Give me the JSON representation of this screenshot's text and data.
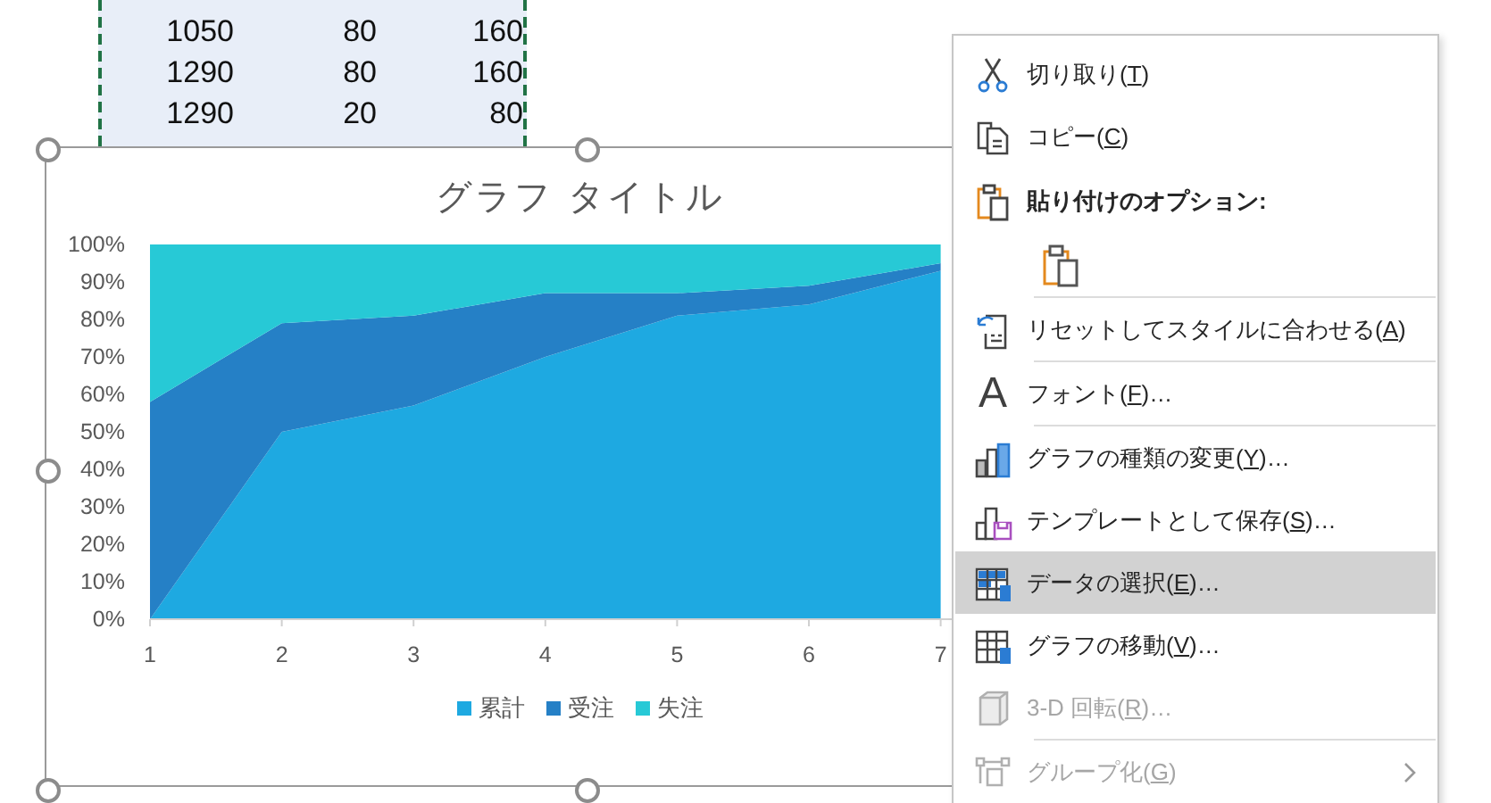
{
  "sheet": {
    "rows": [
      [
        "1050",
        "80",
        "160"
      ],
      [
        "1290",
        "80",
        "160"
      ],
      [
        "1290",
        "20",
        "80"
      ]
    ]
  },
  "chart": {
    "title": "グラフ タイトル",
    "chart_data": {
      "type": "area",
      "stacked": true,
      "categories": [
        "1",
        "2",
        "3",
        "4",
        "5",
        "6",
        "7"
      ],
      "yticks": [
        {
          "value": 0,
          "label": "0%"
        },
        {
          "value": 10,
          "label": "10%"
        },
        {
          "value": 20,
          "label": "20%"
        },
        {
          "value": 30,
          "label": "30%"
        },
        {
          "value": 40,
          "label": "40%"
        },
        {
          "value": 50,
          "label": "50%"
        },
        {
          "value": 60,
          "label": "60%"
        },
        {
          "value": 70,
          "label": "70%"
        },
        {
          "value": 80,
          "label": "80%"
        },
        {
          "value": 90,
          "label": "90%"
        },
        {
          "value": 100,
          "label": "100%"
        }
      ],
      "ylim": [
        0,
        100
      ],
      "series": [
        {
          "name": "累計",
          "color": "#1ea9e1",
          "values": [
            0,
            50,
            57,
            70,
            81,
            84,
            93
          ]
        },
        {
          "name": "受注",
          "color": "#2580c6",
          "values": [
            58,
            29,
            24,
            17,
            6,
            5,
            2
          ]
        },
        {
          "name": "失注",
          "color": "#27c9d6",
          "values": [
            42,
            21,
            19,
            13,
            13,
            11,
            5
          ]
        }
      ]
    }
  },
  "menu": {
    "items": [
      {
        "kind": "item",
        "label": "切り取り(",
        "access_key": "T",
        "tail": ")",
        "selected": false,
        "disabled": false
      },
      {
        "kind": "item",
        "label": "コピー(",
        "access_key": "C",
        "tail": ")",
        "selected": false,
        "disabled": false
      },
      {
        "kind": "header",
        "label": "貼り付けのオプション:"
      },
      {
        "kind": "paste_options"
      },
      {
        "kind": "separator"
      },
      {
        "kind": "item",
        "label": "リセットしてスタイルに合わせる(",
        "access_key": "A",
        "tail": ")",
        "selected": false,
        "disabled": false
      },
      {
        "kind": "separator"
      },
      {
        "kind": "item",
        "glyph": "A",
        "label": "フォント(",
        "access_key": "F",
        "tail": ")…",
        "selected": false,
        "disabled": false
      },
      {
        "kind": "separator"
      },
      {
        "kind": "item",
        "label": "グラフの種類の変更(",
        "access_key": "Y",
        "tail": ")…",
        "selected": false,
        "disabled": false
      },
      {
        "kind": "item",
        "label": "テンプレートとして保存(",
        "access_key": "S",
        "tail": ")…",
        "selected": false,
        "disabled": false
      },
      {
        "kind": "item",
        "label": "データの選択(",
        "access_key": "E",
        "tail": ")…",
        "selected": true,
        "disabled": false
      },
      {
        "kind": "item",
        "label": "グラフの移動(",
        "access_key": "V",
        "tail": ")…",
        "selected": false,
        "disabled": false
      },
      {
        "kind": "item",
        "label": "3-D 回転(",
        "access_key": "R",
        "tail": ")…",
        "selected": false,
        "disabled": true
      },
      {
        "kind": "separator"
      },
      {
        "kind": "item",
        "label": "グループ化(",
        "access_key": "G",
        "tail": ")",
        "selected": false,
        "disabled": true,
        "submenu": true
      }
    ]
  }
}
